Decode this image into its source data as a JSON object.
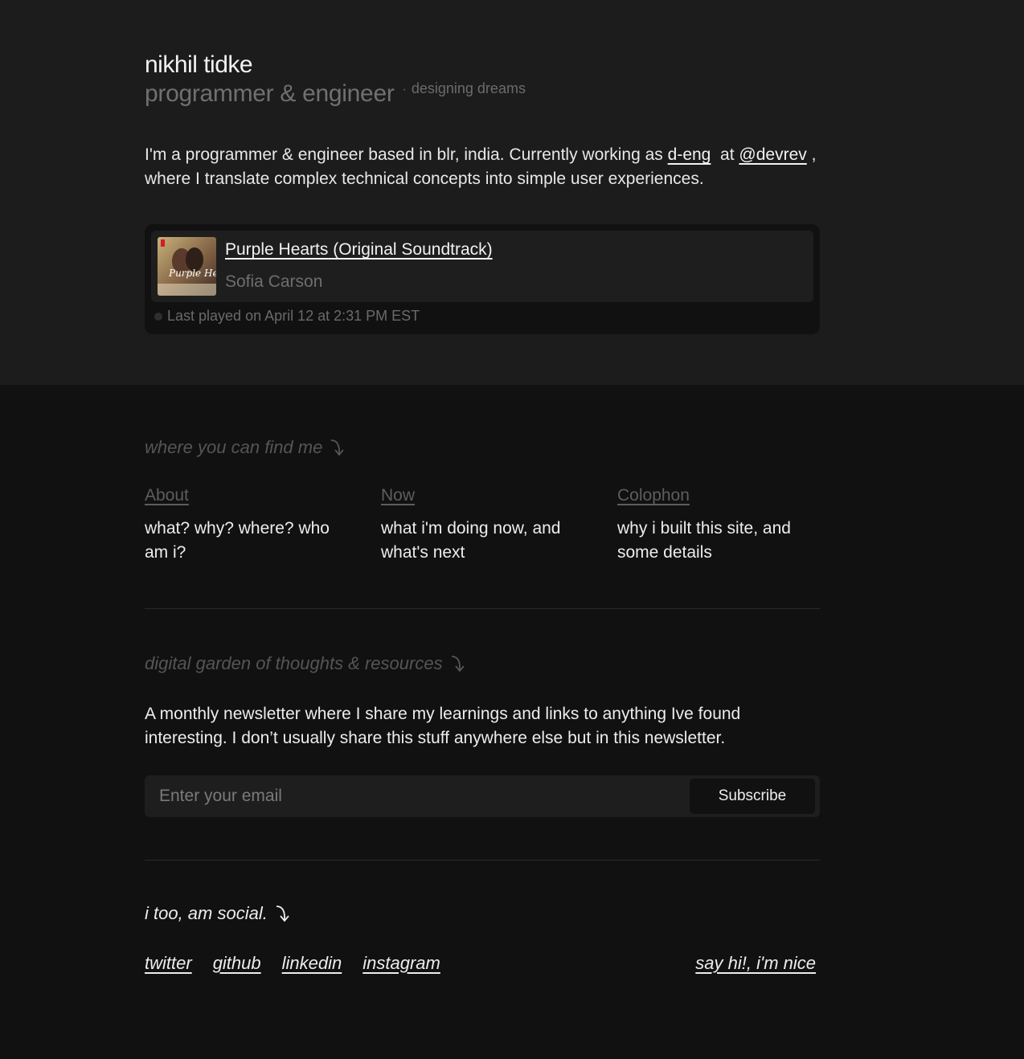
{
  "header": {
    "name": "nikhil tidke",
    "role": "programmer & engineer",
    "separator": "·",
    "tagline": "designing dreams"
  },
  "intro": {
    "part1": "I'm a programmer & engineer based in blr, india. Currently working as ",
    "role_link": "d-eng",
    "part2": "  at ",
    "company_link": "@devrev",
    "part3": " , where I translate complex technical concepts into simple user experiences."
  },
  "now_playing": {
    "title": "Purple Hearts (Original Soundtrack)",
    "artist": "Sofia Carson",
    "status": "Last played on April 12 at 2:31 PM EST",
    "album_art_text": "Purple Hearts"
  },
  "find_me": {
    "label": "where you can find me",
    "cards": [
      {
        "title": "About",
        "desc": "what? why? where? who am i?"
      },
      {
        "title": "Now",
        "desc": "what i'm doing now, and what's next"
      },
      {
        "title": "Colophon",
        "desc": "why i built this site, and some details"
      }
    ]
  },
  "newsletter": {
    "label": "digital garden of thoughts & resources",
    "text": "A monthly newsletter where I share my learnings and links to anything Ive found interesting. I don’t usually share this stuff anywhere else but in this newsletter.",
    "placeholder": "Enter your email",
    "button": "Subscribe"
  },
  "social": {
    "label": "i too, am social.",
    "links": [
      "twitter",
      "github",
      "linkedin",
      "instagram"
    ],
    "contact": "say hi!, i'm nice"
  },
  "colors": {
    "top_bg": "#1c1c1c",
    "bottom_bg": "#111111",
    "muted": "#555555",
    "text": "#ededed"
  }
}
